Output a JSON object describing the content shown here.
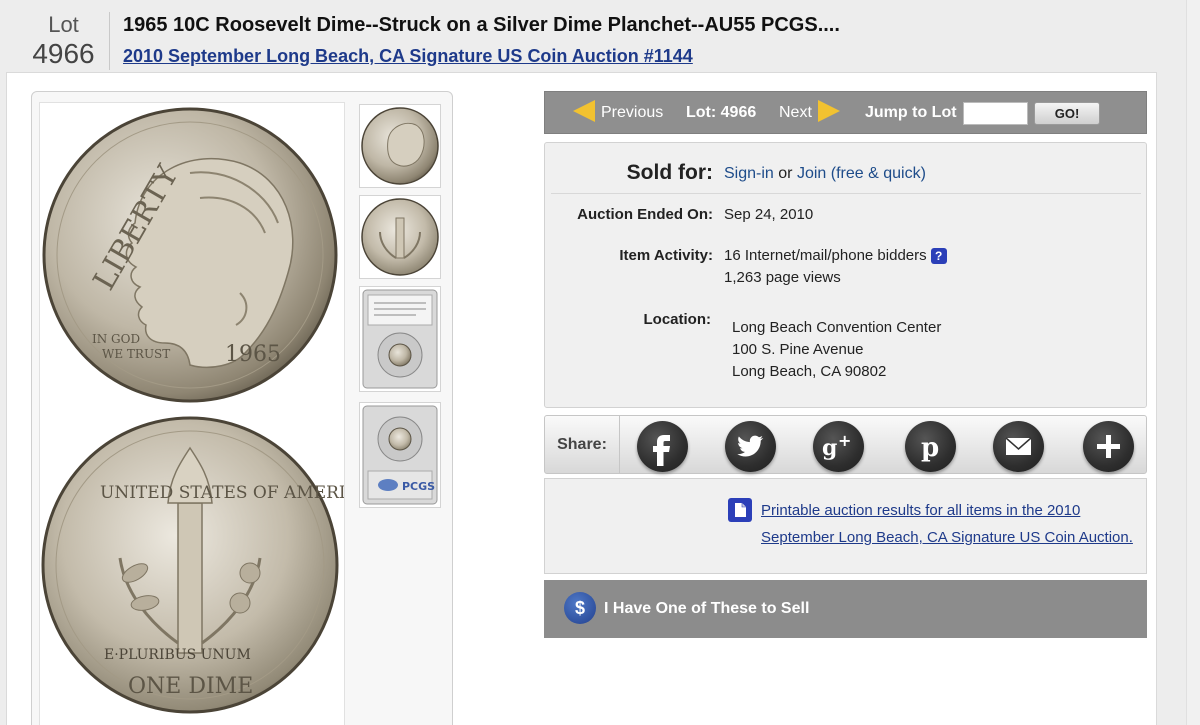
{
  "header": {
    "lot_label": "Lot",
    "lot_number": "4966",
    "title": "1965 10C Roosevelt Dime--Struck on a Silver Dime Planchet--AU55 PCGS....",
    "auction_link": "2010 September Long Beach, CA Signature US Coin Auction #1144"
  },
  "coin_images": {
    "obverse_text": [
      "LIBERTY",
      "IN GOD",
      "WE TRUST",
      "1965"
    ],
    "reverse_text": [
      "UNITED STATES OF AMERICA",
      "E·PLURIBUS UNUM",
      "ONE DIME"
    ],
    "slab_label": "PCGS"
  },
  "nav": {
    "previous_label": "Previous",
    "lot_label": "Lot: 4966",
    "next_label": "Next",
    "jump_label": "Jump to Lot",
    "jump_value": "",
    "go_label": "GO!"
  },
  "info": {
    "sold_label": "Sold for:",
    "signin_label": "Sign-in",
    "or_label": "or",
    "join_label": "Join (free & quick)",
    "ended_label": "Auction Ended On:",
    "ended_value": "Sep 24, 2010",
    "activity_label": "Item Activity:",
    "activity_bidders": "16 Internet/mail/phone bidders",
    "activity_help": "?",
    "activity_views": "1,263 page views",
    "location_label": "Location:",
    "location_line1": "Long Beach Convention Center",
    "location_line2": "100 S. Pine Avenue",
    "location_line3": "Long Beach, CA 90802"
  },
  "share": {
    "label": "Share:",
    "buttons": [
      "facebook",
      "twitter",
      "google-plus",
      "pinterest",
      "email",
      "more"
    ]
  },
  "printable": {
    "link_line1": "Printable auction results for all items in the 2010",
    "link_line2": "September Long Beach, CA Signature US Coin Auction."
  },
  "sell": {
    "icon": "$",
    "label": "I Have One of These to Sell"
  },
  "colors": {
    "link": "#1e3a8a",
    "nav_bg": "#8f8f8f",
    "arrow": "#f2c230",
    "help_badge": "#2b3fb8"
  }
}
